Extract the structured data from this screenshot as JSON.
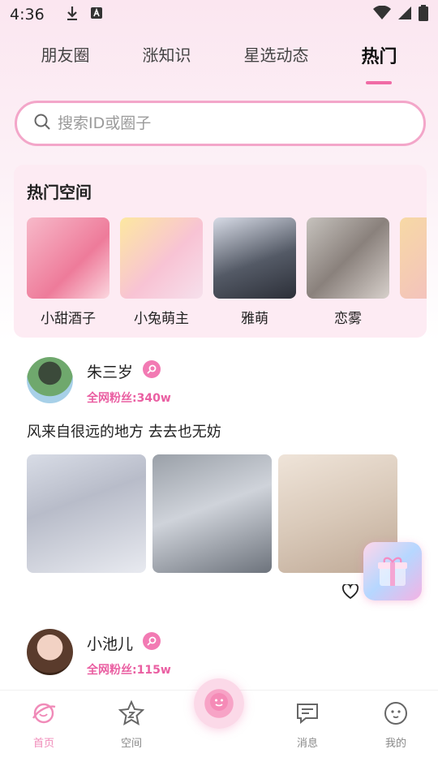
{
  "status_bar": {
    "time": "4:36"
  },
  "tabs": [
    {
      "label": "朋友圈"
    },
    {
      "label": "涨知识"
    },
    {
      "label": "星选动态"
    },
    {
      "label": "热门",
      "active": true
    }
  ],
  "search": {
    "placeholder": "搜索ID或圈子"
  },
  "hot_spaces": {
    "title": "热门空间",
    "items": [
      {
        "name": "小甜酒子"
      },
      {
        "name": "小兔萌主"
      },
      {
        "name": "雅萌"
      },
      {
        "name": "恋雾"
      },
      {
        "name": ""
      }
    ]
  },
  "posts": [
    {
      "username": "朱三岁",
      "fans": "全网粉丝:340w",
      "caption": "风来自很远的地方 去去也无妨"
    },
    {
      "username": "小池儿",
      "fans": "全网粉丝:115w"
    }
  ],
  "bottom_nav": {
    "items": [
      {
        "label": "首页",
        "icon": "home-planet-icon",
        "active": true
      },
      {
        "label": "空间",
        "icon": "star-space-icon"
      },
      {
        "label": "消息",
        "icon": "message-icon"
      },
      {
        "label": "我的",
        "icon": "profile-face-icon"
      }
    ]
  },
  "colors": {
    "accent": "#f06ba5",
    "background_top": "#fbe6f0"
  }
}
